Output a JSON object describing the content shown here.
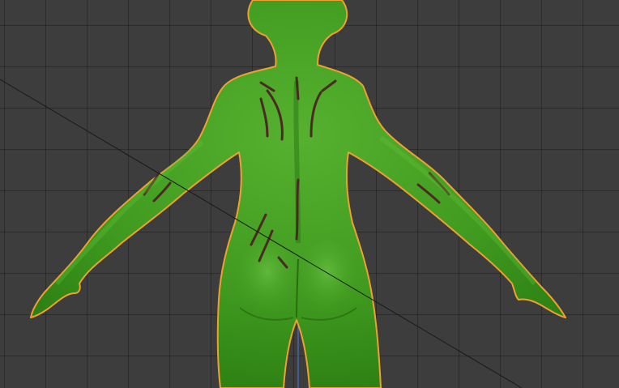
{
  "viewport": {
    "view": "3d-viewport",
    "shading": "solid",
    "selected_object": "character-mesh"
  },
  "colors": {
    "background": "#3d3d3d",
    "grid": "#2f2f2f",
    "mesh": "#3f9a1f",
    "mesh_shadow": "#2c7a14",
    "mesh_highlight": "#63bf3a",
    "selection_outline": "#f0a030",
    "seam": "#4a2a22",
    "axis_line": "#1a1a1a",
    "z_axis": "#4a72c8"
  }
}
